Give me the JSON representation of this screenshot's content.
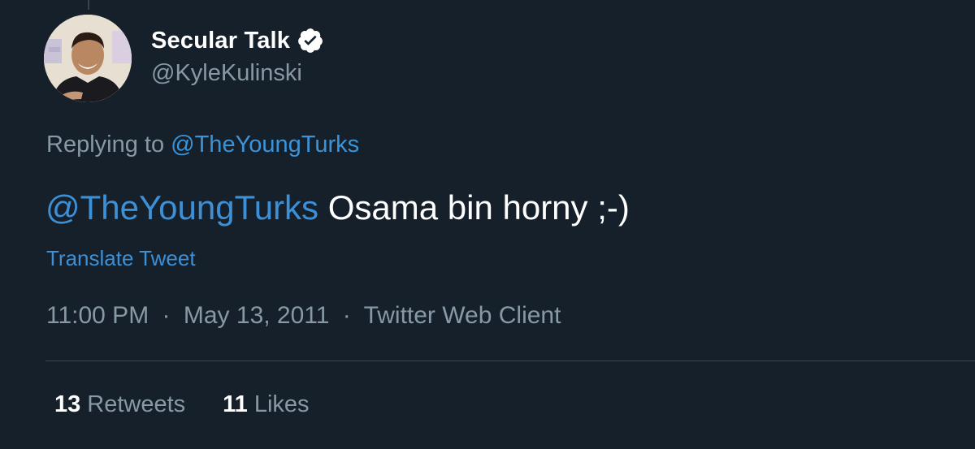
{
  "tweet": {
    "author": {
      "display_name": "Secular Talk",
      "handle": "@KyleKulinski",
      "verified": true
    },
    "replying_to_prefix": "Replying to",
    "replying_to_handle": "@TheYoungTurks",
    "text_mention": "@TheYoungTurks",
    "text_body": " Osama bin horny ;-)",
    "translate_label": "Translate Tweet",
    "time": "11:00 PM",
    "date": "May 13, 2011",
    "client": "Twitter Web Client",
    "separator": "·",
    "stats": {
      "retweets_count": "13",
      "retweets_label": "Retweets",
      "likes_count": "11",
      "likes_label": "Likes"
    }
  },
  "colors": {
    "background": "#15202b",
    "link": "#3d8fd6",
    "secondary_text": "#8899a6",
    "primary_text": "#ffffff",
    "divider": "#38444d"
  },
  "icons": {
    "verified": "verified-badge-icon",
    "avatar": "profile-photo"
  }
}
